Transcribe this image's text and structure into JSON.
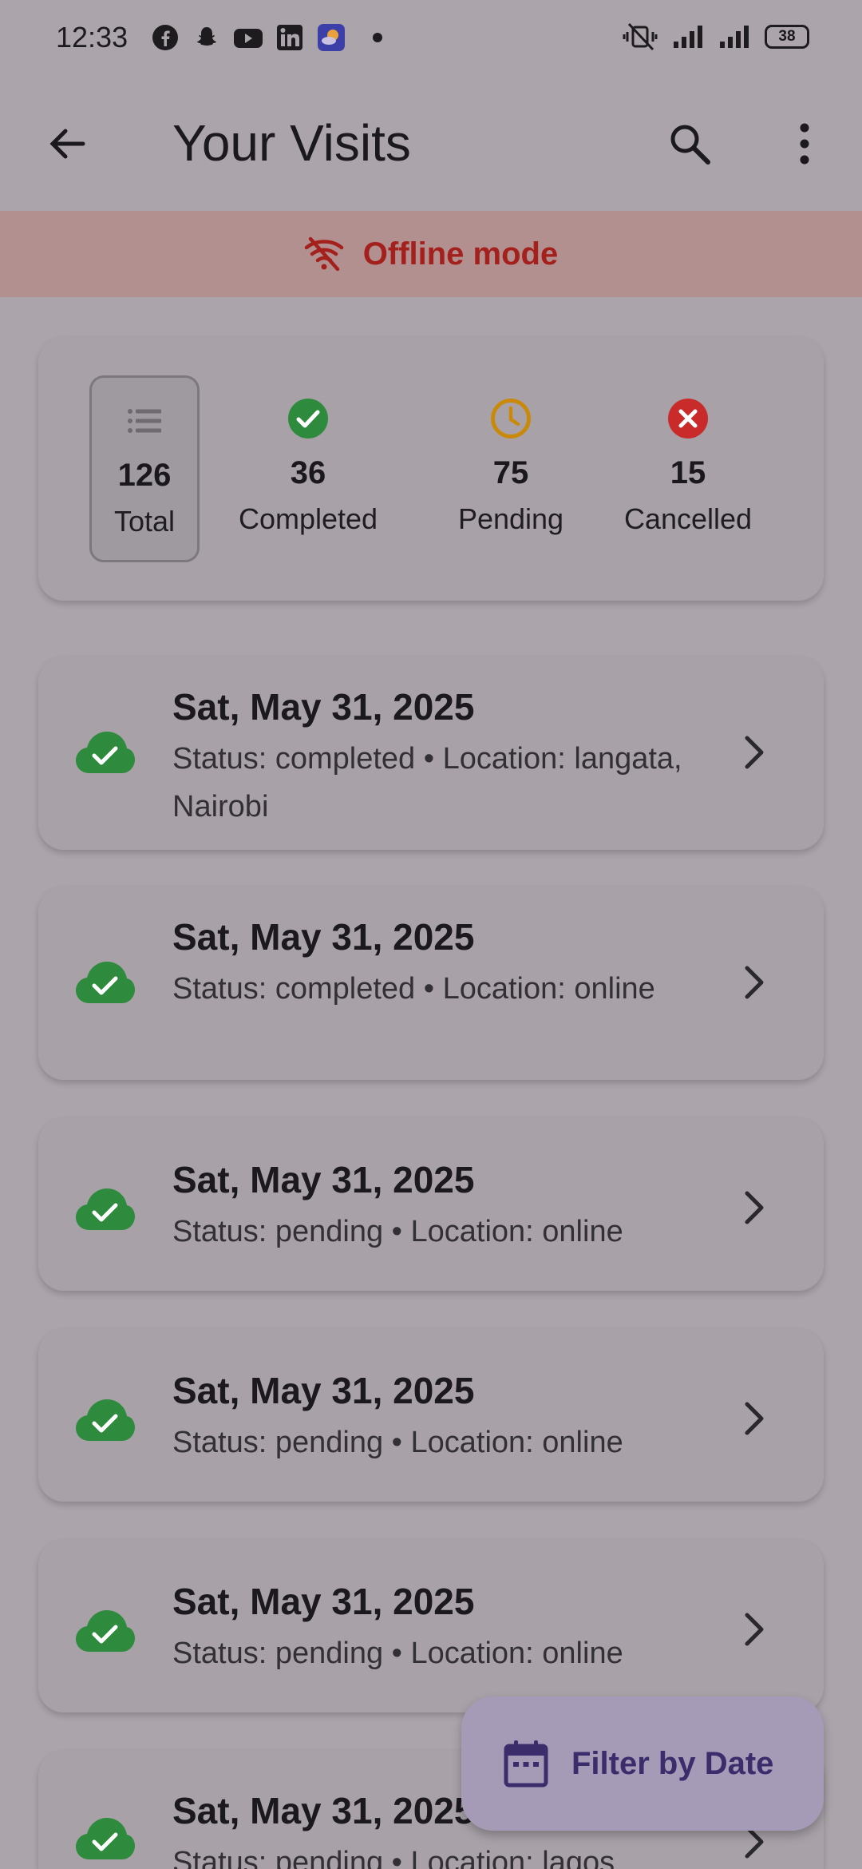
{
  "status_bar": {
    "time": "12:33",
    "battery": "38",
    "app_icons": [
      "facebook-icon",
      "snapchat-icon",
      "youtube-icon",
      "linkedin-icon",
      "weather-icon"
    ]
  },
  "app_bar": {
    "title": "Your Visits"
  },
  "offline_banner": {
    "text": "Offline mode"
  },
  "summary": {
    "total": {
      "count": "126",
      "label": "Total"
    },
    "completed": {
      "count": "36",
      "label": "Completed"
    },
    "pending": {
      "count": "75",
      "label": "Pending"
    },
    "cancelled": {
      "count": "15",
      "label": "Cancelled"
    }
  },
  "visits": [
    {
      "date": "Sat, May 31, 2025",
      "detail": "Status: completed • Location: langata, Nairobi"
    },
    {
      "date": "Sat, May 31, 2025",
      "detail": "Status: completed • Location: online"
    },
    {
      "date": "Sat, May 31, 2025",
      "detail": "Status: pending • Location: online"
    },
    {
      "date": "Sat, May 31, 2025",
      "detail": "Status: pending • Location: online"
    },
    {
      "date": "Sat, May 31, 2025",
      "detail": "Status: pending • Location: online"
    },
    {
      "date": "Sat, May 31, 2025",
      "detail": "Status: pending • Location: lagos"
    }
  ],
  "fab": {
    "label": "Filter by Date"
  },
  "colors": {
    "completed": "#2e8b3d",
    "pending": "#c98a0c",
    "cancelled": "#c92b2b",
    "offline_text": "#a4201c",
    "fab_text": "#3b2c6b"
  }
}
